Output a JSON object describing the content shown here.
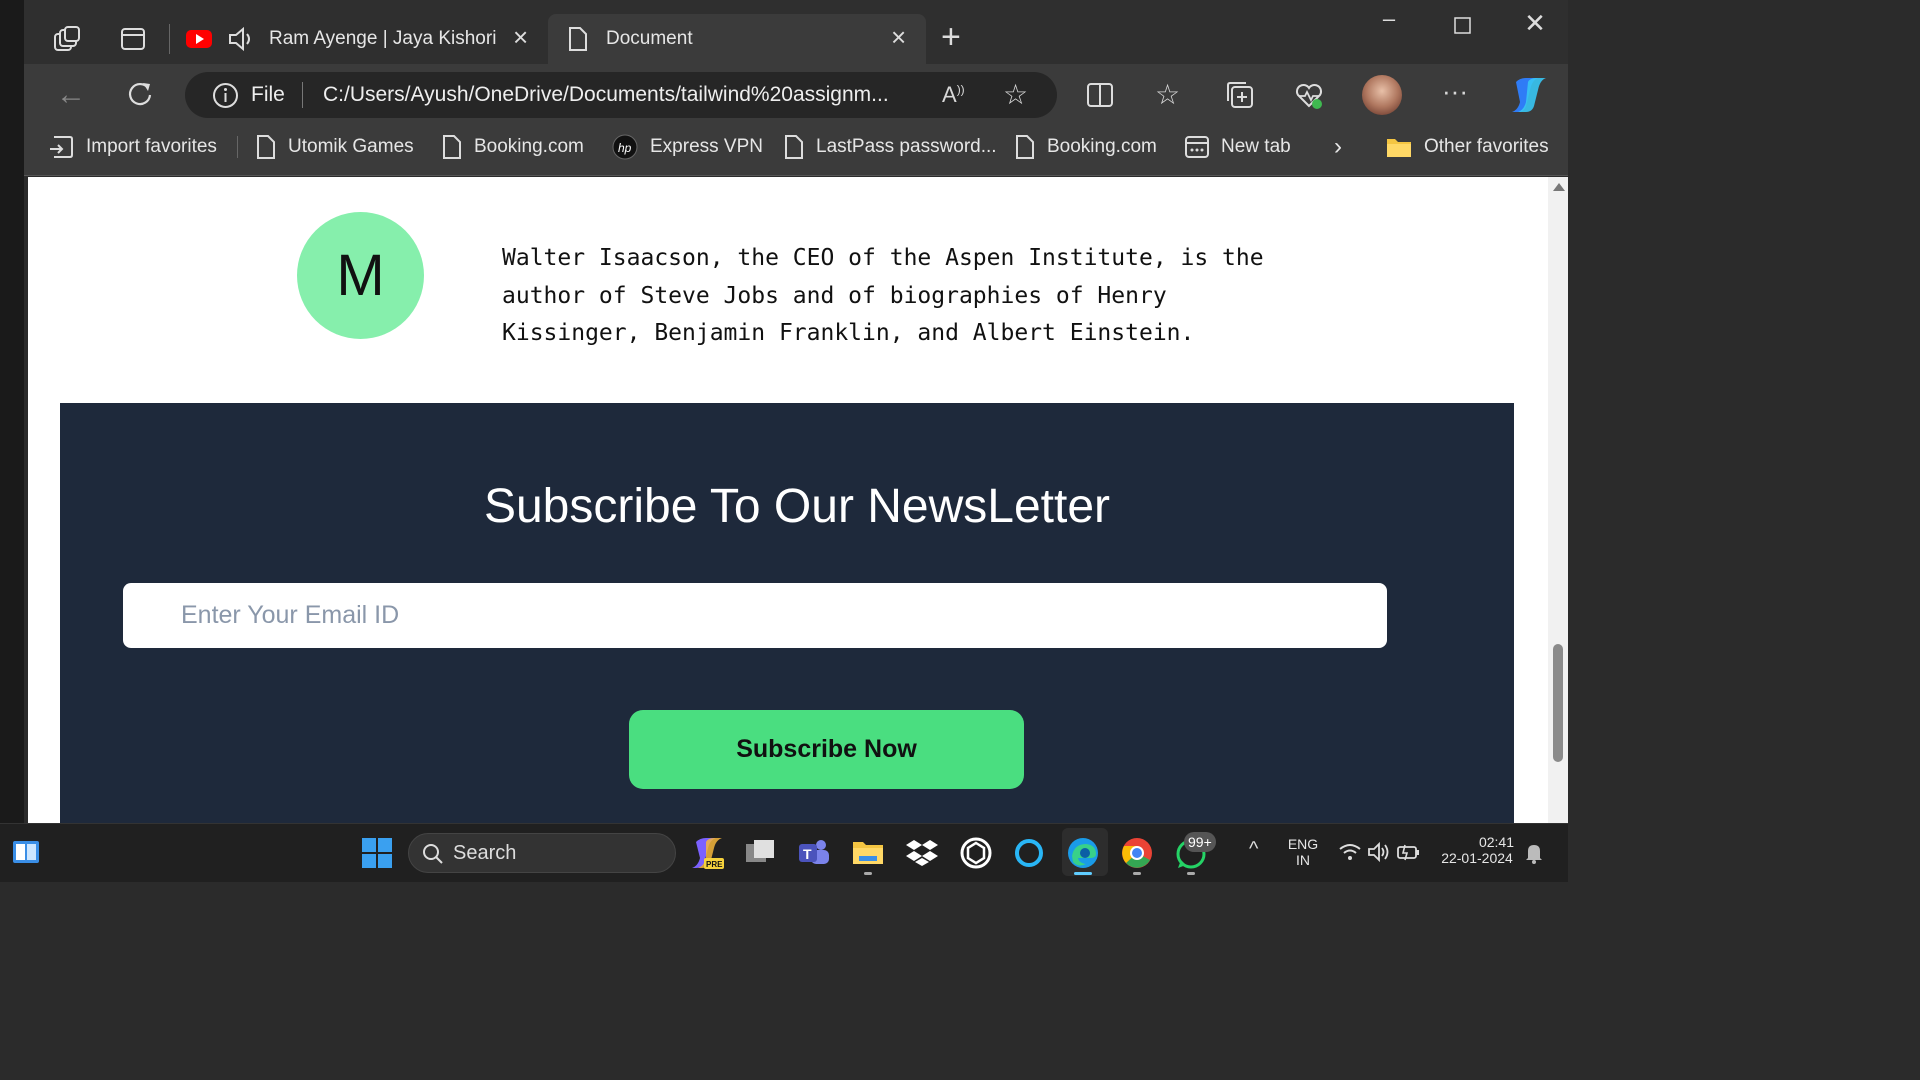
{
  "browser": {
    "tabs": [
      {
        "label": "Ram Ayenge | Jaya Kishori |",
        "icon": "youtube-icon",
        "audio": "speaker-icon"
      },
      {
        "label": "Document",
        "icon": "document-icon",
        "active": true
      }
    ],
    "address": {
      "scheme_label": "File",
      "url": "C:/Users/Ayush/OneDrive/Documents/tailwind%20assignm..."
    },
    "favorites": [
      {
        "label": "Import favorites",
        "icon": "import-icon"
      },
      {
        "label": "Utomik Games",
        "icon": "page-icon"
      },
      {
        "label": "Booking.com",
        "icon": "page-icon"
      },
      {
        "label": "Express VPN",
        "icon": "hp-icon"
      },
      {
        "label": "LastPass password...",
        "icon": "page-icon"
      },
      {
        "label": "Booking.com",
        "icon": "page-icon"
      },
      {
        "label": "New tab",
        "icon": "newtab-icon"
      }
    ],
    "other_favorites": "Other favorites"
  },
  "page": {
    "avatar_letter": "M",
    "bio": "Walter Isaacson, the CEO of the Aspen Institute, is the author of Steve Jobs and of biographies of Henry Kissinger, Benjamin Franklin, and Albert Einstein.",
    "newsletter": {
      "title": "Subscribe To Our NewsLetter",
      "email_placeholder": "Enter Your Email ID",
      "button_label": "Subscribe Now"
    }
  },
  "taskbar": {
    "search_label": "Search",
    "whatsapp_badge": "99+",
    "language": "ENG",
    "region": "IN",
    "time": "02:41",
    "date": "22-01-2024"
  },
  "colors": {
    "avatar_bg": "#86efac",
    "newsletter_bg": "#1e293b",
    "button_bg": "#4ade80"
  }
}
